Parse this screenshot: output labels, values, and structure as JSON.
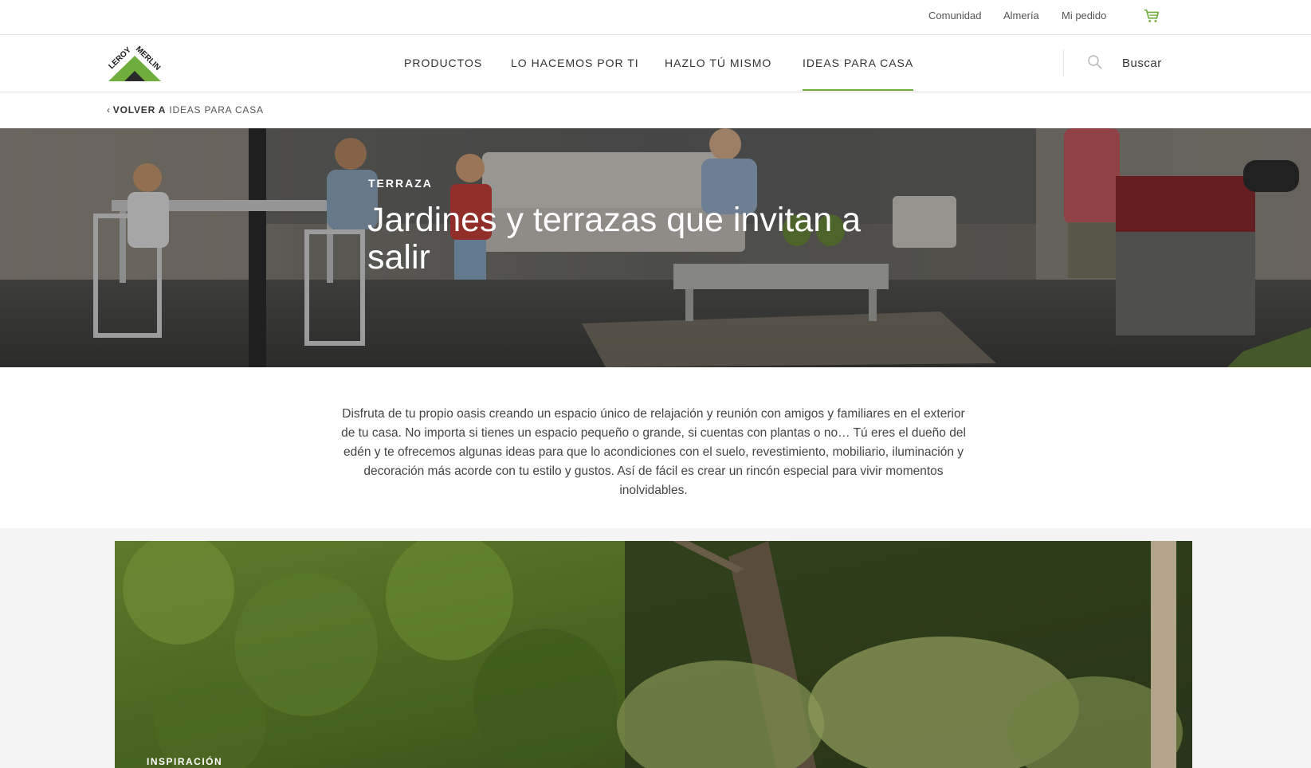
{
  "topbar": {
    "links": [
      "Comunidad",
      "Almería",
      "Mi pedido"
    ],
    "cart_icon": "cart-icon"
  },
  "brand": {
    "logo_text_1": "LEROY",
    "logo_text_2": "MERLIN",
    "accent_color": "#6fae3d"
  },
  "nav": {
    "items": [
      "PRODUCTOS",
      "LO HACEMOS POR TI",
      "HAZLO TÚ MISMO",
      "IDEAS PARA CASA"
    ],
    "active_index": 3,
    "search_icon": "search-icon",
    "search_label": "Buscar"
  },
  "breadcrumb": {
    "prefix": "VOLVER A",
    "target": "IDEAS PARA CASA"
  },
  "hero": {
    "kicker": "TERRAZA",
    "title": "Jardines y terrazas que invitan a salir"
  },
  "intro": {
    "text": "Disfruta de tu propio oasis creando un espacio único de relajación y reunión con amigos y familiares en el exterior de tu casa. No importa si tienes un espacio pequeño o grande, si cuentas con plantas o no… Tú eres el dueño del edén y te ofrecemos algunas ideas para que lo acondiciones con el suelo, revestimiento, mobiliario, iluminación y decoración más acorde con tu estilo y gustos. Así de fácil es crear un rincón especial para vivir momentos inolvidables."
  },
  "feature": {
    "kicker": "INSPIRACIÓN"
  }
}
